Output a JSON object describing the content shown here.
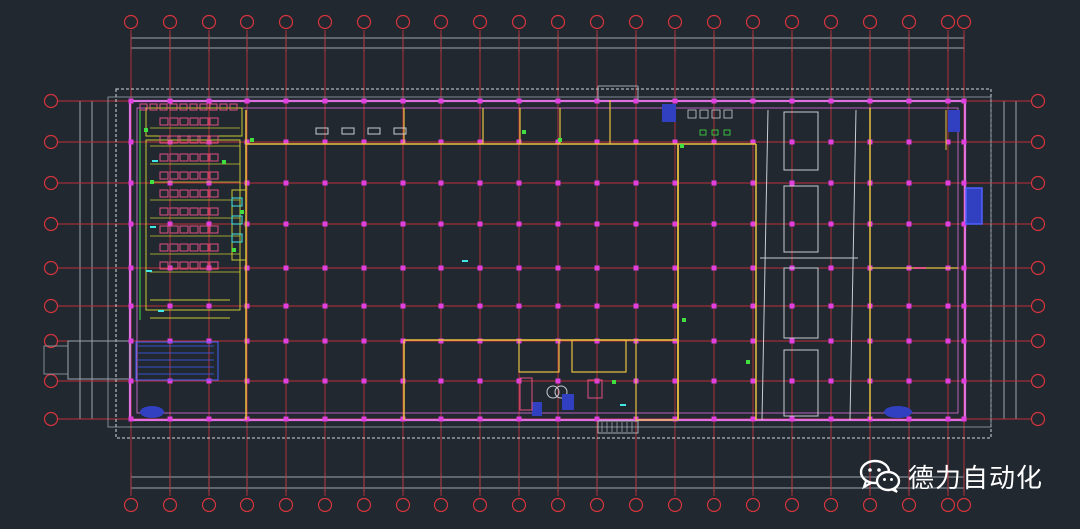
{
  "watermark": {
    "text": "德力自动化",
    "icon": "wechat-icon"
  },
  "colors": {
    "background": "#212830",
    "axis_grid": "#c0303a",
    "bubble": "#d8343c",
    "dimension": "#9aa4ae",
    "outline": "#d4d8dc",
    "wall": "#e070e0",
    "column": "#e040e0",
    "partition": "#e8c040",
    "equipment": "#e05080",
    "yellow_line": "#c8c830",
    "green": "#40e040",
    "cyan": "#40e8e8",
    "blue_fill": "#3040c0",
    "white_line": "#c8ccd0"
  }
}
